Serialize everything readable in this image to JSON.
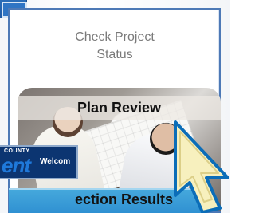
{
  "card": {
    "title": "Check Project\nStatus"
  },
  "plan_review": {
    "label": "Plan Review"
  },
  "county_logo": {
    "caption": "COUNTY",
    "brand": "ent",
    "welcome": "Welcom"
  },
  "bottom_tile": {
    "label": "ection Results"
  },
  "icons": {
    "cursor": "pointer-icon"
  },
  "colors": {
    "card_border": "#4d79b6",
    "county_bg": "#0c3571",
    "bottom_tile": "#2e8fd1",
    "cursor_fill": "#f7f0be",
    "cursor_stroke": "#0b6db8"
  }
}
